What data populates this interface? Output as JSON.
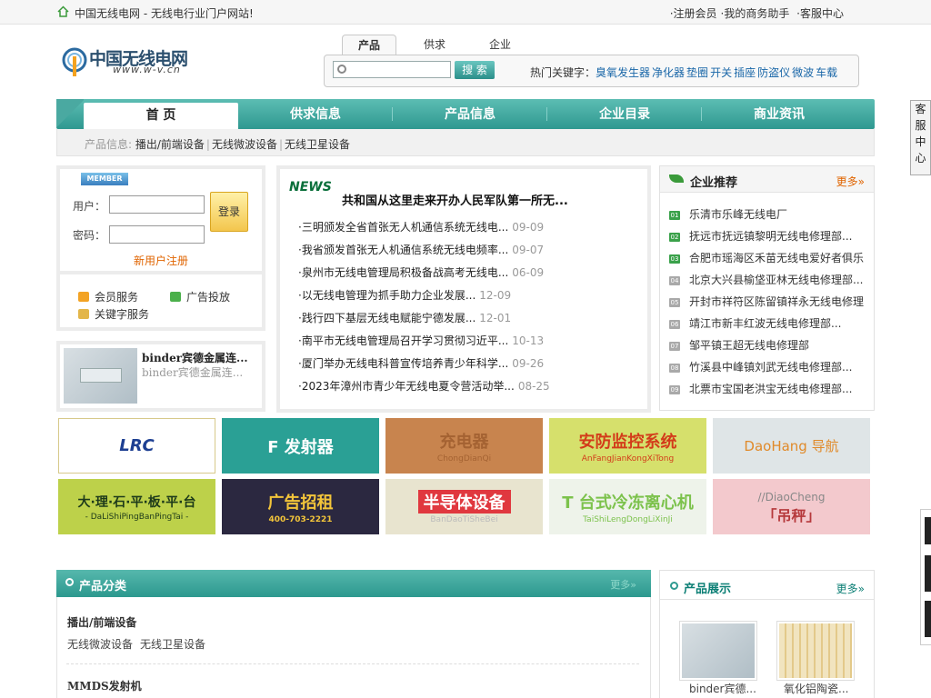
{
  "topbar": {
    "site_title": "中国无线电网 - 无线电行业门户网站!",
    "links": [
      "·注册会员",
      "·我的商务助手",
      "·客服中心"
    ]
  },
  "logo": {
    "text": "中国无线电网",
    "url_text": "www.w-v.cn"
  },
  "search": {
    "tabs": [
      "产品",
      "供求",
      "企业"
    ],
    "active_tab": "产品",
    "placeholder": "",
    "button_label": "搜 索",
    "hot_label": "热门关键字：",
    "hot_keywords": [
      "臭氧发生器",
      "净化器",
      "垫圈",
      "开关",
      "插座",
      "防盗仪",
      "微波",
      "车载"
    ]
  },
  "nav": {
    "items": [
      "首 页",
      "供求信息",
      "产品信息",
      "企业目录",
      "商业资讯"
    ],
    "active": "首 页"
  },
  "subnav": {
    "label": "产品信息:",
    "links": [
      "播出/前端设备",
      "无线微波设备",
      "无线卫星设备"
    ]
  },
  "member": {
    "badge": "MEMBER",
    "username_label": "用户：",
    "password_label": "密码：",
    "login_button": "登录",
    "register_link": "新用户注册",
    "services": [
      "会员服务",
      "广告投放",
      "关键字服务"
    ]
  },
  "featured_product": {
    "title": "binder宾德金属连...",
    "subtitle": "binder宾德金属连..."
  },
  "news": {
    "logo": "NEWS",
    "headline": "共和国从这里走来开办人民军队第一所无...",
    "items": [
      {
        "title": "·三明颁发全省首张无人机通信系统无线电...",
        "date": "09-09"
      },
      {
        "title": "·我省颁发首张无人机通信系统无线电频率...",
        "date": "09-07"
      },
      {
        "title": "·泉州市无线电管理局积极备战高考无线电...",
        "date": "06-09"
      },
      {
        "title": "·以无线电管理为抓手助力企业发展...",
        "date": "12-09"
      },
      {
        "title": "·践行四下基层无线电赋能宁德发展...",
        "date": "12-01"
      },
      {
        "title": "·南平市无线电管理局召开学习贯彻习近平...",
        "date": "10-13"
      },
      {
        "title": "·厦门举办无线电科普宣传培养青少年科学...",
        "date": "09-26"
      },
      {
        "title": "·2023年漳州市青少年无线电夏令营活动举...",
        "date": "08-25"
      }
    ]
  },
  "recommend": {
    "title": "企业推荐",
    "more": "更多»",
    "items": [
      {
        "num": "01",
        "name": "乐清市乐峰无线电厂"
      },
      {
        "num": "02",
        "name": "抚远市抚远镇黎明无线电修理部..."
      },
      {
        "num": "03",
        "name": "合肥市瑶海区禾苗无线电爱好者俱乐"
      },
      {
        "num": "04",
        "name": "北京大兴县榆垡亚林无线电修理部..."
      },
      {
        "num": "05",
        "name": "开封市祥符区陈留镇祥永无线电修理"
      },
      {
        "num": "06",
        "name": "靖江市新丰红波无线电修理部..."
      },
      {
        "num": "07",
        "name": "邹平镇王超无线电修理部"
      },
      {
        "num": "08",
        "name": "竹溪县中峰镇刘武无线电修理部..."
      },
      {
        "num": "09",
        "name": "北票市宝国老洪宝无线电修理部..."
      }
    ]
  },
  "ads": [
    {
      "main": "LRC",
      "sub": "",
      "bg": "#ffffff",
      "fg": "#1d3f92"
    },
    {
      "main": "F 发射器",
      "sub": "",
      "bg": "#2aa095",
      "fg": "#ffffff"
    },
    {
      "main": "充电器",
      "sub": "ChongDianQi",
      "bg": "#c8844e",
      "fg": "#a46232"
    },
    {
      "main": "安防监控系统",
      "sub": "AnFangJianKongXiTong",
      "bg": "#d6e06c",
      "fg": "#d33c1a"
    },
    {
      "main": "DaoHang 导航",
      "sub": "",
      "bg": "#dfe5e7",
      "fg": "#e08a2a"
    },
    {
      "main": "大·理·石·平·板·平·台",
      "sub": "- DaLiShiPingBanPingTai -",
      "bg": "#bdd14a",
      "fg": "#1d3a1a"
    },
    {
      "main": "广告招租",
      "sub": "400-703-2221",
      "bg": "#2b2840",
      "fg": "#f3c53a"
    },
    {
      "main": "半导体设备",
      "sub": "BanDaoTiSheBei",
      "bg": "#e8e4cf",
      "fg": "#ffffff"
    },
    {
      "main": "T 台式冷冻离心机",
      "sub": "TaiShiLengDongLiXinJi",
      "bg": "#eef3ea",
      "fg": "#7cc24c"
    },
    {
      "main": "「吊秤」",
      "sub": "//DiaoCheng",
      "bg": "#f3c9cd",
      "fg": "#b6393c"
    }
  ],
  "categories": {
    "title": "产品分类",
    "more": "更多»",
    "groups": [
      {
        "name": "播出/前端设备",
        "items": [
          "无线微波设备",
          "无线卫星设备"
        ]
      },
      {
        "name": "MMDS发射机",
        "items": []
      }
    ]
  },
  "showcase": {
    "title": "产品展示",
    "more": "更多»",
    "items": [
      "binder宾德...",
      "氧化铝陶瓷..."
    ]
  },
  "sidebar_widget": {
    "label": [
      "客",
      "服",
      "中",
      "心"
    ]
  },
  "colors": {
    "teal": "#2f9a90",
    "orange": "#e06400",
    "link": "#1a67a8"
  }
}
